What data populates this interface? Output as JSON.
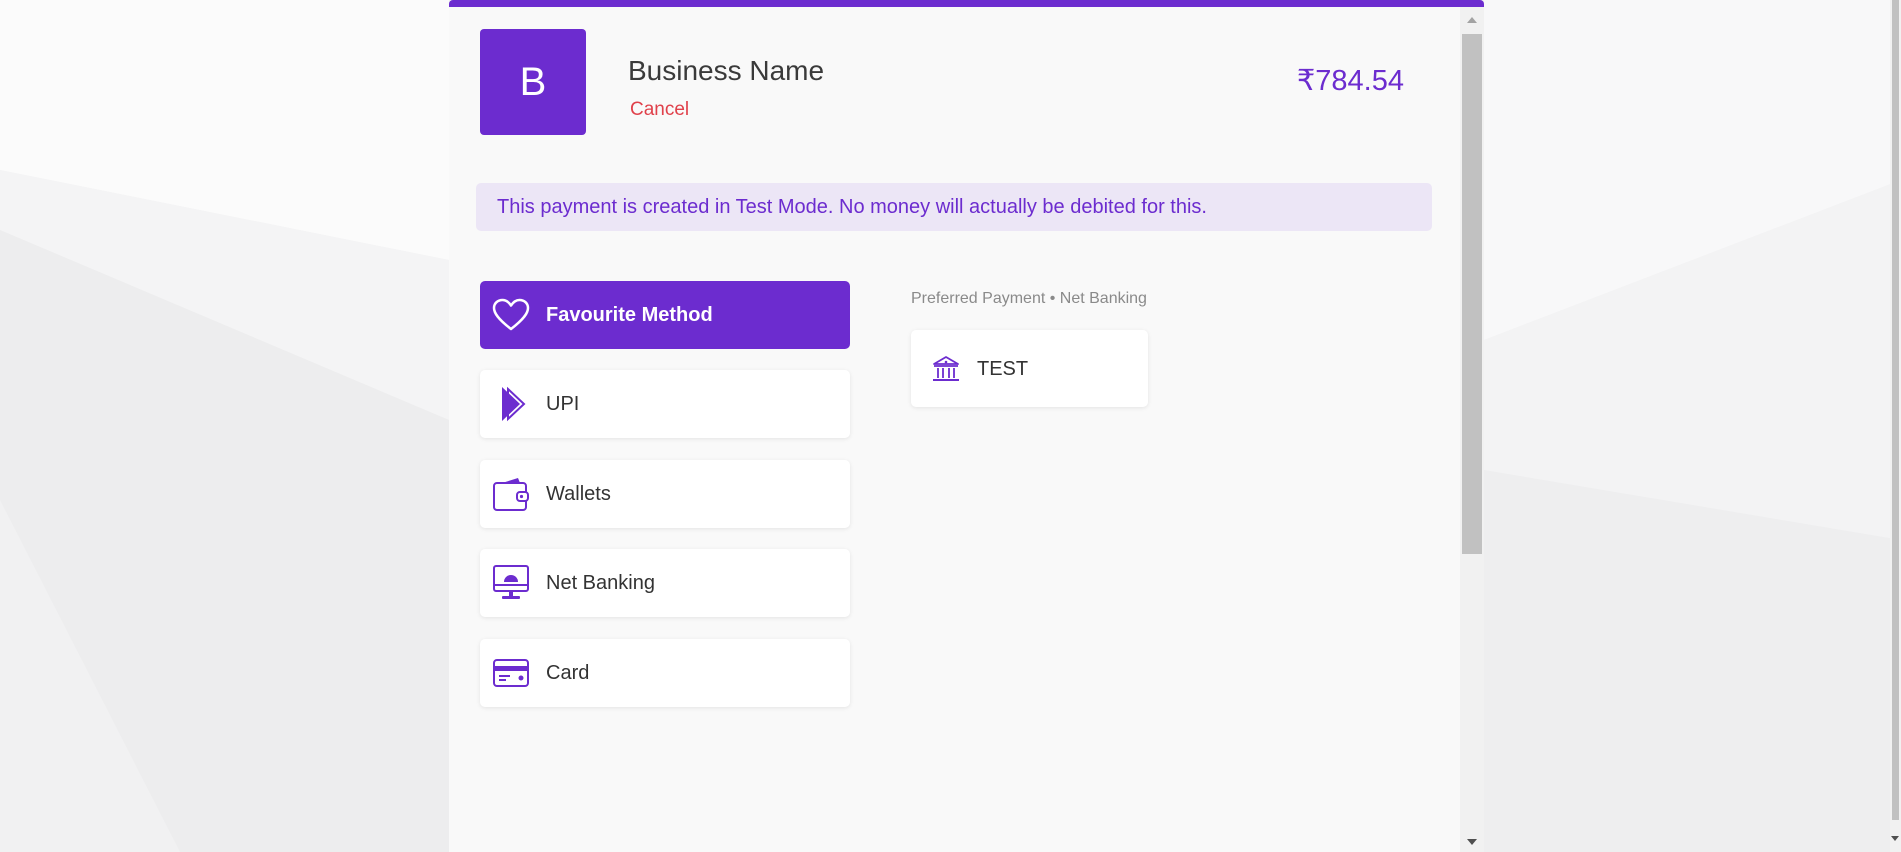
{
  "header": {
    "logo_letter": "B",
    "business_name": "Business Name",
    "cancel_label": "Cancel",
    "amount": "₹784.54"
  },
  "banner": {
    "text": "This payment is created in Test Mode. No money will actually be debited for this."
  },
  "methods": [
    {
      "label": "Favourite Method",
      "icon": "heart-icon",
      "active": true
    },
    {
      "label": "UPI",
      "icon": "upi-icon",
      "active": false
    },
    {
      "label": "Wallets",
      "icon": "wallet-icon",
      "active": false
    },
    {
      "label": "Net Banking",
      "icon": "net-banking-icon",
      "active": false
    },
    {
      "label": "Card",
      "icon": "card-icon",
      "active": false
    }
  ],
  "preferred": {
    "title": "Preferred Payment • Net Banking",
    "items": [
      {
        "label": "TEST",
        "icon": "bank-icon"
      }
    ]
  },
  "colors": {
    "accent": "#6c2ccf",
    "cancel": "#e0414b",
    "banner_bg": "#ece6f6"
  }
}
